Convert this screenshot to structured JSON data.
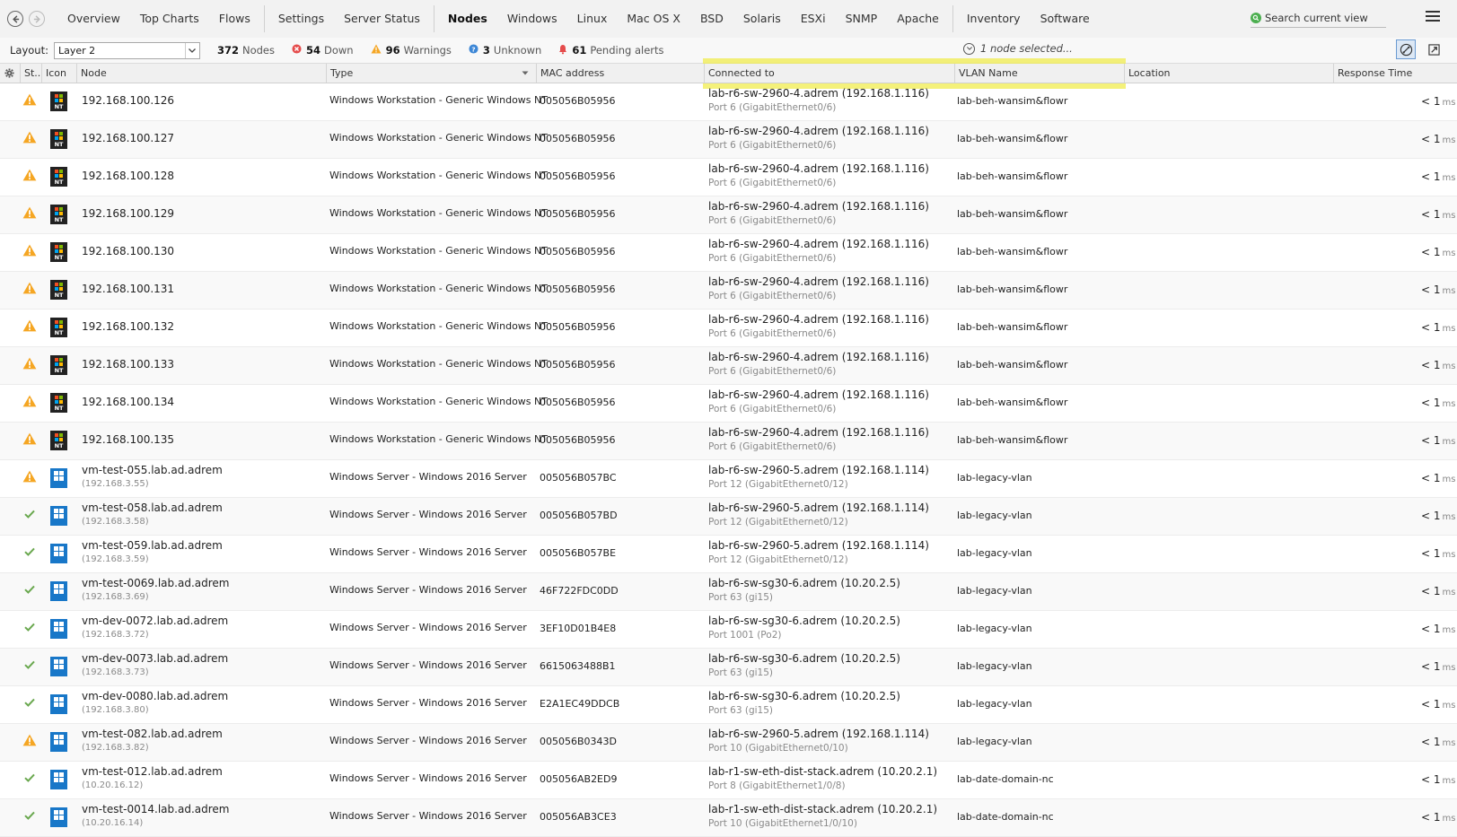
{
  "nav": {
    "tabs": [
      "Overview",
      "Top Charts",
      "Flows",
      "Settings",
      "Server Status",
      "Nodes",
      "Windows",
      "Linux",
      "Mac OS X",
      "BSD",
      "Solaris",
      "ESXi",
      "SNMP",
      "Apache",
      "Inventory",
      "Software"
    ],
    "active_tab": "Nodes",
    "search_placeholder": "Search current view"
  },
  "toolbar": {
    "layout_label": "Layout:",
    "layout_value": "Layer 2",
    "stats": {
      "nodes_count": "372",
      "nodes_label": "Nodes",
      "down_count": "54",
      "down_label": "Down",
      "warnings_count": "96",
      "warnings_label": "Warnings",
      "unknown_count": "3",
      "unknown_label": "Unknown",
      "pending_count": "61",
      "pending_label": "Pending alerts"
    },
    "selection_text": "1 node selected..."
  },
  "columns": {
    "status": "St...",
    "icon": "Icon",
    "node": "Node",
    "type": "Type",
    "mac": "MAC address",
    "connected": "Connected to",
    "vlan": "VLAN Name",
    "location": "Location",
    "response": "Response Time"
  },
  "colors": {
    "warning": "#f5a623",
    "ok": "#6aa84f",
    "highlight": "#f0eb46"
  },
  "rows": [
    {
      "status": "warning",
      "icon": "nt",
      "node": "192.168.100.126",
      "sub": "",
      "type": "Windows Workstation - Generic Windows NT",
      "mac": "005056B05956",
      "conn": "lab-r6-sw-2960-4.adrem (192.168.1.116)",
      "port": "Port 6  (GigabitEthernet0/6)",
      "vlan": "lab-beh-wansim&flowr",
      "lt": "<",
      "resp": "1",
      "unit": "ms"
    },
    {
      "status": "warning",
      "icon": "nt",
      "node": "192.168.100.127",
      "sub": "",
      "type": "Windows Workstation - Generic Windows NT",
      "mac": "005056B05956",
      "conn": "lab-r6-sw-2960-4.adrem (192.168.1.116)",
      "port": "Port 6  (GigabitEthernet0/6)",
      "vlan": "lab-beh-wansim&flowr",
      "lt": "<",
      "resp": "1",
      "unit": "ms"
    },
    {
      "status": "warning",
      "icon": "nt",
      "node": "192.168.100.128",
      "sub": "",
      "type": "Windows Workstation - Generic Windows NT",
      "mac": "005056B05956",
      "conn": "lab-r6-sw-2960-4.adrem (192.168.1.116)",
      "port": "Port 6  (GigabitEthernet0/6)",
      "vlan": "lab-beh-wansim&flowr",
      "lt": "<",
      "resp": "1",
      "unit": "ms"
    },
    {
      "status": "warning",
      "icon": "nt",
      "node": "192.168.100.129",
      "sub": "",
      "type": "Windows Workstation - Generic Windows NT",
      "mac": "005056B05956",
      "conn": "lab-r6-sw-2960-4.adrem (192.168.1.116)",
      "port": "Port 6  (GigabitEthernet0/6)",
      "vlan": "lab-beh-wansim&flowr",
      "lt": "<",
      "resp": "1",
      "unit": "ms"
    },
    {
      "status": "warning",
      "icon": "nt",
      "node": "192.168.100.130",
      "sub": "",
      "type": "Windows Workstation - Generic Windows NT",
      "mac": "005056B05956",
      "conn": "lab-r6-sw-2960-4.adrem (192.168.1.116)",
      "port": "Port 6  (GigabitEthernet0/6)",
      "vlan": "lab-beh-wansim&flowr",
      "lt": "<",
      "resp": "1",
      "unit": "ms"
    },
    {
      "status": "warning",
      "icon": "nt",
      "node": "192.168.100.131",
      "sub": "",
      "type": "Windows Workstation - Generic Windows NT",
      "mac": "005056B05956",
      "conn": "lab-r6-sw-2960-4.adrem (192.168.1.116)",
      "port": "Port 6  (GigabitEthernet0/6)",
      "vlan": "lab-beh-wansim&flowr",
      "lt": "<",
      "resp": "1",
      "unit": "ms"
    },
    {
      "status": "warning",
      "icon": "nt",
      "node": "192.168.100.132",
      "sub": "",
      "type": "Windows Workstation - Generic Windows NT",
      "mac": "005056B05956",
      "conn": "lab-r6-sw-2960-4.adrem (192.168.1.116)",
      "port": "Port 6  (GigabitEthernet0/6)",
      "vlan": "lab-beh-wansim&flowr",
      "lt": "<",
      "resp": "1",
      "unit": "ms"
    },
    {
      "status": "warning",
      "icon": "nt",
      "node": "192.168.100.133",
      "sub": "",
      "type": "Windows Workstation - Generic Windows NT",
      "mac": "005056B05956",
      "conn": "lab-r6-sw-2960-4.adrem (192.168.1.116)",
      "port": "Port 6  (GigabitEthernet0/6)",
      "vlan": "lab-beh-wansim&flowr",
      "lt": "<",
      "resp": "1",
      "unit": "ms"
    },
    {
      "status": "warning",
      "icon": "nt",
      "node": "192.168.100.134",
      "sub": "",
      "type": "Windows Workstation - Generic Windows NT",
      "mac": "005056B05956",
      "conn": "lab-r6-sw-2960-4.adrem (192.168.1.116)",
      "port": "Port 6  (GigabitEthernet0/6)",
      "vlan": "lab-beh-wansim&flowr",
      "lt": "<",
      "resp": "1",
      "unit": "ms"
    },
    {
      "status": "warning",
      "icon": "nt",
      "node": "192.168.100.135",
      "sub": "",
      "type": "Windows Workstation - Generic Windows NT",
      "mac": "005056B05956",
      "conn": "lab-r6-sw-2960-4.adrem (192.168.1.116)",
      "port": "Port 6  (GigabitEthernet0/6)",
      "vlan": "lab-beh-wansim&flowr",
      "lt": "<",
      "resp": "1",
      "unit": "ms"
    },
    {
      "status": "warning",
      "icon": "win",
      "node": "vm-test-055.lab.ad.adrem",
      "sub": "(192.168.3.55)",
      "type": "Windows Server - Windows 2016 Server",
      "mac": "005056B057BC",
      "conn": "lab-r6-sw-2960-5.adrem (192.168.1.114)",
      "port": "Port 12  (GigabitEthernet0/12)",
      "vlan": "lab-legacy-vlan",
      "lt": "<",
      "resp": "1",
      "unit": "ms"
    },
    {
      "status": "ok",
      "icon": "win",
      "node": "vm-test-058.lab.ad.adrem",
      "sub": "(192.168.3.58)",
      "type": "Windows Server - Windows 2016 Server",
      "mac": "005056B057BD",
      "conn": "lab-r6-sw-2960-5.adrem (192.168.1.114)",
      "port": "Port 12  (GigabitEthernet0/12)",
      "vlan": "lab-legacy-vlan",
      "lt": "<",
      "resp": "1",
      "unit": "ms"
    },
    {
      "status": "ok",
      "icon": "win",
      "node": "vm-test-059.lab.ad.adrem",
      "sub": "(192.168.3.59)",
      "type": "Windows Server - Windows 2016 Server",
      "mac": "005056B057BE",
      "conn": "lab-r6-sw-2960-5.adrem (192.168.1.114)",
      "port": "Port 12  (GigabitEthernet0/12)",
      "vlan": "lab-legacy-vlan",
      "lt": "<",
      "resp": "1",
      "unit": "ms"
    },
    {
      "status": "ok",
      "icon": "win",
      "node": "vm-test-0069.lab.ad.adrem",
      "sub": "(192.168.3.69)",
      "type": "Windows Server - Windows 2016 Server",
      "mac": "46F722FDC0DD",
      "conn": "lab-r6-sw-sg30-6.adrem (10.20.2.5)",
      "port": "Port 63  (gi15)",
      "vlan": "lab-legacy-vlan",
      "lt": "<",
      "resp": "1",
      "unit": "ms"
    },
    {
      "status": "ok",
      "icon": "win",
      "node": "vm-dev-0072.lab.ad.adrem",
      "sub": "(192.168.3.72)",
      "type": "Windows Server - Windows 2016 Server",
      "mac": "3EF10D01B4E8",
      "conn": "lab-r6-sw-sg30-6.adrem (10.20.2.5)",
      "port": "Port 1001  (Po2)",
      "vlan": "lab-legacy-vlan",
      "lt": "<",
      "resp": "1",
      "unit": "ms"
    },
    {
      "status": "ok",
      "icon": "win",
      "node": "vm-dev-0073.lab.ad.adrem",
      "sub": "(192.168.3.73)",
      "type": "Windows Server - Windows 2016 Server",
      "mac": "6615063488B1",
      "conn": "lab-r6-sw-sg30-6.adrem (10.20.2.5)",
      "port": "Port 63  (gi15)",
      "vlan": "lab-legacy-vlan",
      "lt": "<",
      "resp": "1",
      "unit": "ms"
    },
    {
      "status": "ok",
      "icon": "win",
      "node": "vm-dev-0080.lab.ad.adrem",
      "sub": "(192.168.3.80)",
      "type": "Windows Server - Windows 2016 Server",
      "mac": "E2A1EC49DDCB",
      "conn": "lab-r6-sw-sg30-6.adrem (10.20.2.5)",
      "port": "Port 63  (gi15)",
      "vlan": "lab-legacy-vlan",
      "lt": "<",
      "resp": "1",
      "unit": "ms"
    },
    {
      "status": "warning",
      "icon": "win",
      "node": "vm-test-082.lab.ad.adrem",
      "sub": "(192.168.3.82)",
      "type": "Windows Server - Windows 2016 Server",
      "mac": "005056B0343D",
      "conn": "lab-r6-sw-2960-5.adrem (192.168.1.114)",
      "port": "Port 10  (GigabitEthernet0/10)",
      "vlan": "lab-legacy-vlan",
      "lt": "<",
      "resp": "1",
      "unit": "ms"
    },
    {
      "status": "ok",
      "icon": "win",
      "node": "vm-test-012.lab.ad.adrem",
      "sub": "(10.20.16.12)",
      "type": "Windows Server - Windows 2016 Server",
      "mac": "005056AB2ED9",
      "conn": "lab-r1-sw-eth-dist-stack.adrem (10.20.2.1)",
      "port": "Port 8  (GigabitEthernet1/0/8)",
      "vlan": "lab-date-domain-nc",
      "lt": "<",
      "resp": "1",
      "unit": "ms"
    },
    {
      "status": "ok",
      "icon": "win",
      "node": "vm-test-0014.lab.ad.adrem",
      "sub": "(10.20.16.14)",
      "type": "Windows Server - Windows 2016 Server",
      "mac": "005056AB3CE3",
      "conn": "lab-r1-sw-eth-dist-stack.adrem (10.20.2.1)",
      "port": "Port 10  (GigabitEthernet1/0/10)",
      "vlan": "lab-date-domain-nc",
      "lt": "<",
      "resp": "1",
      "unit": "ms"
    }
  ]
}
